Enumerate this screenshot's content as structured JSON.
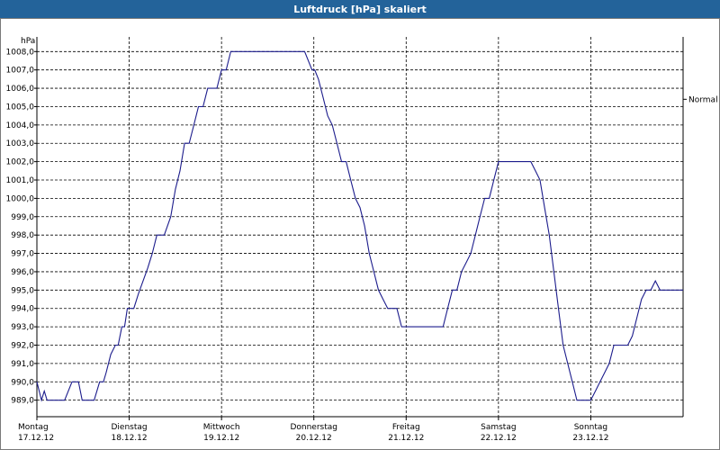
{
  "window": {
    "title": "Luftdruck [hPa] skaliert"
  },
  "chart_data": {
    "type": "line",
    "title": "Luftdruck [hPa] skaliert",
    "ylabel": "hPa",
    "ylim": [
      988.1,
      1008.8
    ],
    "yticks": [
      989.0,
      990.0,
      991.0,
      992.0,
      993.0,
      994.0,
      995.0,
      996.0,
      997.0,
      998.0,
      999.0,
      1000.0,
      1001.0,
      1002.0,
      1003.0,
      1004.0,
      1005.0,
      1006.0,
      1007.0,
      1008.0
    ],
    "ytick_labels": [
      "989,0",
      "990,0",
      "991,0",
      "992,0",
      "993,0",
      "994,0",
      "995,0",
      "996,0",
      "997,0",
      "998,0",
      "999,0",
      "1000,0",
      "1001,0",
      "1002,0",
      "1003,0",
      "1004,0",
      "1005,0",
      "1006,0",
      "1007,0",
      "1008,0"
    ],
    "xlim": [
      0,
      7
    ],
    "x_unit": "days since Montag 17.12.12 00:00",
    "xticks": [
      {
        "day": "Montag",
        "date": "17.12.12"
      },
      {
        "day": "Dienstag",
        "date": "18.12.12"
      },
      {
        "day": "Mittwoch",
        "date": "19.12.12"
      },
      {
        "day": "Donnerstag",
        "date": "20.12.12"
      },
      {
        "day": "Freitag",
        "date": "21.12.12"
      },
      {
        "day": "Samstag",
        "date": "22.12.12"
      },
      {
        "day": "Sonntag",
        "date": "23.12.12"
      }
    ],
    "reference_line": {
      "label": "Normal",
      "value": 1005.4
    },
    "grid": true,
    "series": [
      {
        "color": "#1c1c8c",
        "x": [
          0.0,
          0.05,
          0.08,
          0.11,
          0.15,
          0.3,
          0.38,
          0.45,
          0.49,
          0.52,
          0.55,
          0.62,
          0.68,
          0.72,
          0.75,
          0.8,
          0.85,
          0.88,
          0.92,
          0.95,
          0.98,
          1.02,
          1.05,
          1.1,
          1.15,
          1.2,
          1.25,
          1.3,
          1.38,
          1.45,
          1.5,
          1.55,
          1.6,
          1.65,
          1.7,
          1.75,
          1.8,
          1.85,
          1.9,
          1.95,
          2.0,
          2.05,
          2.1,
          2.15,
          2.2,
          2.3,
          2.35,
          2.4,
          2.45,
          2.5,
          2.6,
          2.7,
          2.8,
          2.9,
          2.98,
          3.01,
          3.05,
          3.1,
          3.15,
          3.2,
          3.25,
          3.3,
          3.35,
          3.4,
          3.45,
          3.5,
          3.55,
          3.6,
          3.65,
          3.7,
          3.75,
          3.8,
          3.85,
          3.9,
          3.95,
          4.0,
          4.1,
          4.14,
          4.2,
          4.3,
          4.4,
          4.45,
          4.5,
          4.55,
          4.6,
          4.65,
          4.7,
          4.75,
          4.8,
          4.85,
          4.9,
          4.95,
          5.0,
          5.05,
          5.1,
          5.15,
          5.2,
          5.25,
          5.3,
          5.35,
          5.4,
          5.45,
          5.5,
          5.55,
          5.6,
          5.65,
          5.7,
          5.75,
          5.8,
          5.85,
          5.9,
          5.95,
          6.0,
          6.05,
          6.1,
          6.15,
          6.2,
          6.25,
          6.3,
          6.35,
          6.4,
          6.45,
          6.5,
          6.55,
          6.6,
          6.65,
          6.7,
          6.75,
          6.8,
          6.85,
          6.9,
          6.95,
          7.0
        ],
        "y": [
          990.0,
          989.0,
          989.5,
          989.0,
          989.0,
          989.0,
          990.0,
          990.0,
          989.0,
          989.0,
          989.0,
          989.0,
          990.0,
          990.0,
          990.5,
          991.5,
          992.0,
          992.0,
          993.0,
          993.0,
          994.0,
          994.0,
          994.0,
          994.8,
          995.5,
          996.2,
          997.0,
          998.0,
          998.0,
          999.0,
          1000.5,
          1001.5,
          1003.0,
          1003.0,
          1004.0,
          1005.0,
          1005.0,
          1006.0,
          1006.0,
          1006.0,
          1007.0,
          1007.0,
          1008.0,
          1008.0,
          1008.0,
          1008.0,
          1008.0,
          1008.0,
          1008.0,
          1008.0,
          1008.0,
          1008.0,
          1008.0,
          1008.0,
          1007.0,
          1007.0,
          1006.5,
          1005.5,
          1004.5,
          1004.0,
          1003.0,
          1002.0,
          1002.0,
          1001.0,
          1000.0,
          999.5,
          998.5,
          997.0,
          996.0,
          995.0,
          994.5,
          994.0,
          994.0,
          994.0,
          993.0,
          993.0,
          993.0,
          993.0,
          993.0,
          993.0,
          993.0,
          994.0,
          995.0,
          995.0,
          996.0,
          996.5,
          997.0,
          998.0,
          999.0,
          1000.0,
          1000.0,
          1001.0,
          1002.0,
          1002.0,
          1002.0,
          1002.0,
          1002.0,
          1002.0,
          1002.0,
          1002.0,
          1001.5,
          1001.0,
          999.5,
          998.0,
          996.0,
          994.0,
          992.0,
          991.0,
          990.0,
          989.0,
          989.0,
          989.0,
          989.0,
          989.5,
          990.0,
          990.5,
          991.0,
          992.0,
          992.0,
          992.0,
          992.0,
          992.5,
          993.5,
          994.5,
          995.0,
          995.0,
          995.5,
          995.0,
          995.0,
          995.0,
          995.0,
          995.0,
          995.0
        ]
      }
    ]
  }
}
